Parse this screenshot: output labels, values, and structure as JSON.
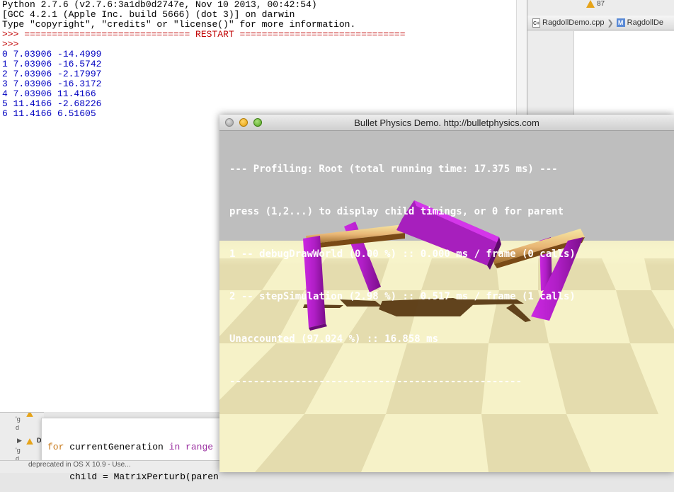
{
  "xcode": {
    "warning_count": "87",
    "jumpbar": {
      "file_1": "RagdollDemo.cpp",
      "file_2": "RagdollDe",
      "file_1_icon": "cpp-file-icon",
      "file_2_icon": "m-file-icon"
    }
  },
  "python_shell": {
    "lines": [
      "Python 2.7.6 (v2.7.6:3a1db0d2747e, Nov 10 2013, 00:42:54)",
      "[GCC 4.2.1 (Apple Inc. build 5666) (dot 3)] on darwin",
      "Type \"copyright\", \"credits\" or \"license()\" for more information."
    ],
    "restart_line": ">>> ============================== RESTART ==============================",
    "prompt": ">>>",
    "output": [
      "0 7.03906 -14.4999",
      "1 7.03906 -16.5742",
      "2 7.03906 -2.17997",
      "3 7.03906 -16.3172",
      "4 7.03906 11.4166",
      "5 11.4166 -2.68226",
      "6 11.4166 6.51605"
    ]
  },
  "issue_nav": {
    "row1": "'g",
    "row2": "d",
    "row3": "D",
    "row4": "'g",
    "row5": "d"
  },
  "code_editor": {
    "line1_kw": "for",
    "line1_var": " currentGeneration ",
    "line1_kw2": "in",
    "line1_rest": " range",
    "line2": "    child = MatrixPerturb(paren"
  },
  "bottom_strip": {
    "text": "deprecated in OS X 10.9 - Use..."
  },
  "bullet_window": {
    "title": "Bullet Physics Demo. http://bulletphysics.com",
    "profiler_lines": [
      "--- Profiling: Root (total running time: 17.375 ms) ---",
      "press (1,2...) to display child timings, or 0 for parent",
      "1 -- debugDrawWorld (0.00 %) :: 0.000 ms / frame (0 calls)",
      "2 -- stepSimulation (2.98 %) :: 0.517 ms / frame (1 calls)",
      "Unaccounted (97.024 %) :: 16.858 ms",
      "-------------------------------------------------"
    ]
  },
  "colors": {
    "prompt": "#c00000",
    "output": "#0000c0",
    "leg": "#b41ccc",
    "floor_light": "#ffffd6",
    "floor_dark": "#e8e2b4",
    "shadow": "#5a3a14"
  }
}
